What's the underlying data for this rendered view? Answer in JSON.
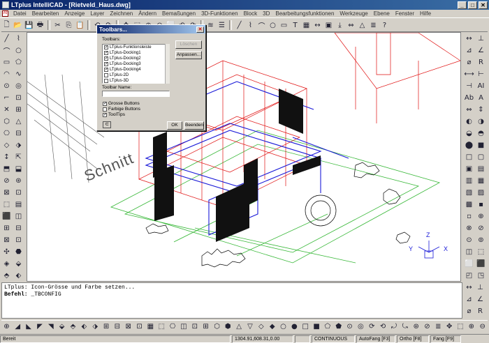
{
  "window": {
    "title": "LTplus IntelliCAD - [Rietveld_Haus.dwg]",
    "minimize": "_",
    "maximize": "□",
    "close": "✕"
  },
  "menu": [
    "Datei",
    "Bearbeiten",
    "Anzeige",
    "Layer",
    "Zeichnen",
    "Ändern",
    "Bemaßungen",
    "3D-Funktionen",
    "Block",
    "3D",
    "Bearbeitungsfunktionen",
    "Werkzeuge",
    "Ebene",
    "Fenster",
    "Hilfe"
  ],
  "toolbar_top": [
    "new-icon",
    "open-icon",
    "save-icon",
    "print-icon",
    "cut-icon",
    "copy-icon",
    "paste-icon",
    "undo-icon",
    "redo-icon",
    "pan-icon",
    "zoom-window-icon",
    "zoom-in-icon",
    "zoom-out-icon",
    "zoom-all-icon",
    "zoom-prev-icon",
    "refresh-icon",
    "layer-icon",
    "properties-icon",
    "line-icon",
    "pline-icon",
    "arc-icon",
    "circle-icon",
    "rect-icon",
    "text-icon",
    "hatch-icon",
    "dim-icon",
    "block-icon",
    "insert-icon",
    "measure-icon",
    "area-icon",
    "list-icon",
    "help-icon"
  ],
  "toolbar_top_glyphs": [
    "🗋",
    "📂",
    "💾",
    "🖶",
    "✂",
    "⎘",
    "📋",
    "↶",
    "↷",
    "✥",
    "⬚",
    "⊕",
    "⊖",
    "⬜",
    "⟲",
    "⟳",
    "≋",
    "☰",
    "╱",
    "⌇",
    "⌒",
    "○",
    "▭",
    "T",
    "▦",
    "↔",
    "▣",
    "⤓",
    "⇔",
    "△",
    "≣",
    "?"
  ],
  "toolbar_left_glyphs": [
    "╱",
    "⌇",
    "⌒",
    "○",
    "▭",
    "⬠",
    "◠",
    "∿",
    "⊙",
    "◎",
    "⌐",
    "⊡",
    "✕",
    "⊞",
    "⬡",
    "△",
    "⎔",
    "⊟",
    "◇",
    "⬗",
    "↕",
    "⇱",
    "⬒",
    "⬓",
    "⊘",
    "⊛",
    "⊠",
    "⊡",
    "⬚",
    "▤",
    "⬛",
    "◫",
    "⊞",
    "⊟",
    "⊠",
    "⊡",
    "✣",
    "⬣",
    "◈",
    "⬙",
    "⬘",
    "⬖"
  ],
  "toolbar_right_glyphs": [
    "↔",
    "⊥",
    "⊿",
    "∠",
    "⌀",
    "R",
    "⟷",
    "⊢",
    "⊣",
    "AI",
    "Ab",
    "A",
    "⇔",
    "⇕",
    "◐",
    "◑",
    "◒",
    "◓",
    "⬤",
    "■",
    "□",
    "▢",
    "▣",
    "▤",
    "▥",
    "▦",
    "▧",
    "▨",
    "▩",
    "▪",
    "▫",
    "⊕",
    "⊗",
    "⊘",
    "⊙",
    "⊚",
    "◫",
    "⬚",
    "⬜",
    "⬛",
    "◰",
    "◳"
  ],
  "toolbar_bottom_glyphs": [
    "⊕",
    "◢",
    "◣",
    "◤",
    "◥",
    "⬙",
    "⬘",
    "⬖",
    "⬗",
    "⊞",
    "⊟",
    "⊠",
    "⊡",
    "▦",
    "⬚",
    "⎔",
    "◫",
    "⊡",
    "⊞",
    "⬡",
    "⬢",
    "△",
    "▽",
    "◇",
    "◆",
    "○",
    "●",
    "□",
    "■",
    "⬠",
    "⬟",
    "⊙",
    "◎",
    "⟳",
    "⟲",
    "⤾",
    "⤿",
    "⊛",
    "⊘",
    "≣",
    "✥",
    "⬚",
    "⊕",
    "⊖"
  ],
  "drawing": {
    "label": "Schnitt",
    "ucs": {
      "x": "X",
      "y": "Y",
      "z": "Z"
    }
  },
  "command": {
    "history": "LTplus: Icon-Grösse und Farbe setzen...",
    "prompt": "Befehl:",
    "input": "_TBCONFIG"
  },
  "status": {
    "ready": "Bereit",
    "coords": "1304.91,608.31,0.00",
    "linetype": "CONTINUOUS",
    "autofang": "AutoFang [F3]",
    "ortho": "Ortho [F8]",
    "fang": "Fang [F9]"
  },
  "dialog": {
    "title": "Toolbars...",
    "list_label": "Toolbars:",
    "items": [
      {
        "label": "LTplus-Funktionsleiste",
        "checked": true
      },
      {
        "label": "LTplus-Docking1",
        "checked": true
      },
      {
        "label": "LTplus-Docking2",
        "checked": true
      },
      {
        "label": "LTplus-Docking3",
        "checked": true
      },
      {
        "label": "LTplus-Docking4",
        "checked": true
      },
      {
        "label": "LTplus-2D",
        "checked": false
      },
      {
        "label": "LTplus-3D",
        "checked": false
      }
    ],
    "delete_button": "Löschen",
    "customize_button": "Anpassen...",
    "name_label": "Toolbar Name:",
    "name_value": "",
    "options": [
      {
        "label": "Grosse Buttons",
        "checked": true
      },
      {
        "label": "Farbige Buttons",
        "checked": false
      },
      {
        "label": "ToolTips",
        "checked": true
      }
    ],
    "ok_button": "OK",
    "cancel_button": "Beenden"
  },
  "colors": {
    "canvas": "#ffffff",
    "wire_red": "#e01010",
    "wire_blue": "#1a1ad8",
    "wire_green": "#38b838",
    "titlebar": "#0a246a"
  }
}
